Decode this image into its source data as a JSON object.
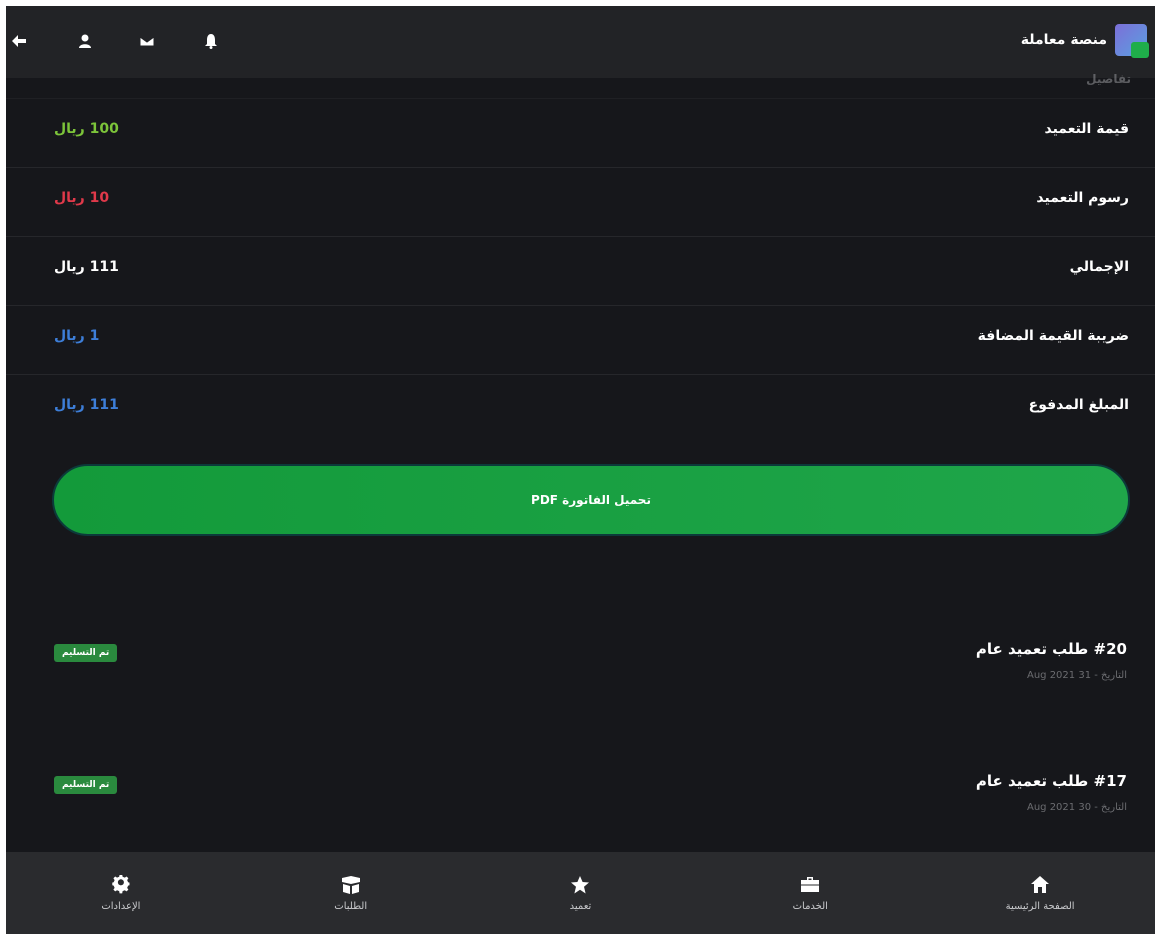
{
  "header": {
    "brand": "منصة معاملة",
    "icons": [
      "back-arrow-icon",
      "user-icon",
      "envelope-icon",
      "bell-icon"
    ]
  },
  "cutoff_text": "تفاصيل",
  "details": [
    {
      "label": "قيمة التعميد",
      "value": "100 ريال",
      "color": "#7cc43a"
    },
    {
      "label": "رسوم التعميد",
      "value": "10 ريال",
      "color": "#e0394a"
    },
    {
      "label": "الإجمالي",
      "value": "111 ريال",
      "color": "#ffffff"
    },
    {
      "label": "ضريبة القيمة المضافة",
      "value": "1 ريال",
      "color": "#3d7ed8"
    },
    {
      "label": "المبلغ المدفوع",
      "value": "111 ريال",
      "color": "#3d7ed8"
    }
  ],
  "pdf_button": "تحميل الفاتورة PDF",
  "orders": [
    {
      "title": "#20 طلب تعميد عام",
      "date": "التاريخ - 31 Aug 2021",
      "status": "تم التسليم"
    },
    {
      "title": "#17 طلب تعميد عام",
      "date": "التاريخ - 30 Aug 2021",
      "status": "تم التسليم"
    }
  ],
  "bottom_nav": [
    {
      "label": "الإعدادات",
      "icon": "gear-icon"
    },
    {
      "label": "الطلبات",
      "icon": "box-icon"
    },
    {
      "label": "تعميد",
      "icon": "star-icon"
    },
    {
      "label": "الخدمات",
      "icon": "briefcase-icon"
    },
    {
      "label": "الصفحة الرئيسية",
      "icon": "home-icon"
    }
  ]
}
